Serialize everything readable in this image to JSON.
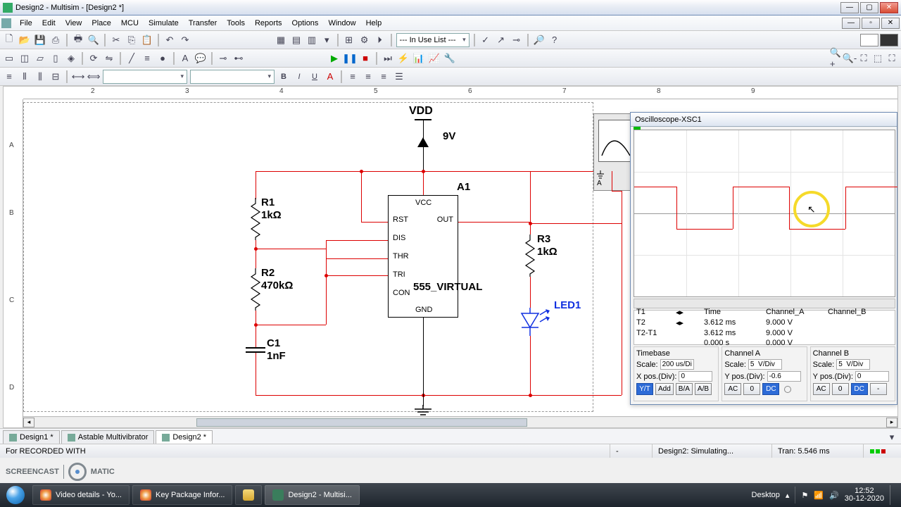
{
  "window": {
    "title": "Design2 - Multisim - [Design2 *]"
  },
  "menu": [
    "File",
    "Edit",
    "View",
    "Place",
    "MCU",
    "Simulate",
    "Transfer",
    "Tools",
    "Reports",
    "Options",
    "Window",
    "Help"
  ],
  "toolbar": {
    "inuse": "--- In Use List ---"
  },
  "ruler": {
    "h": [
      "2",
      "3",
      "4",
      "5",
      "6",
      "7",
      "8",
      "9"
    ],
    "v": [
      "A",
      "B",
      "C",
      "D"
    ]
  },
  "schematic": {
    "vdd": "VDD",
    "voltage": "9V",
    "chip_ref": "A1",
    "chip_name": "555_VIRTUAL",
    "pins": [
      "VCC",
      "RST",
      "OUT",
      "DIS",
      "THR",
      "TRI",
      "CON",
      "GND"
    ],
    "r1_name": "R1",
    "r1_val": "1kΩ",
    "r2_name": "R2",
    "r2_val": "470kΩ",
    "r3_name": "R3",
    "r3_val": "1kΩ",
    "c1_name": "C1",
    "c1_val": "1nF",
    "led": "LED1"
  },
  "scope": {
    "title": "Oscilloscope-XSC1",
    "cursor_rows": [
      "T1",
      "T2",
      "T2-T1"
    ],
    "cursor_hdr": [
      "Time",
      "Channel_A",
      "Channel_B"
    ],
    "readout": {
      "t1_time": "3.612 ms",
      "t1_a": "9.000 V",
      "t2_time": "3.612 ms",
      "t2_a": "9.000 V",
      "dt_time": "0.000 s",
      "dt_a": "0.000 V"
    },
    "timebase_lbl": "Timebase",
    "ch_a_lbl": "Channel A",
    "ch_b_lbl": "Channel B",
    "scale_lbl": "Scale:",
    "xpos_lbl": "X pos.(Div):",
    "ypos_lbl": "Y pos.(Div):",
    "tb_scale": "200 us/Div",
    "a_scale": "5  V/Div",
    "a_ypos": "-0.6",
    "b_scale": "5  V/Div",
    "b_ypos": "0",
    "xpos": "0",
    "btns_tb": [
      "Y/T",
      "Add",
      "B/A",
      "A/B"
    ],
    "btns_ch": [
      "AC",
      "0",
      "DC"
    ]
  },
  "tabs": [
    "Design1 *",
    "Astable Multivibrator",
    "Design2 *"
  ],
  "status": {
    "rec": "For RECORDED WITH",
    "sim": "Design2: Simulating...",
    "tran": "Tran: 5.546 ms"
  },
  "taskbar": {
    "items": [
      "Video details - Yo...",
      "Key Package Infor...",
      "",
      "Design2 - Multisi..."
    ],
    "desktop": "Desktop",
    "time": "12:52",
    "date": "30-12-2020"
  },
  "watermark": {
    "a": "SCREENCAST",
    "b": "MATIC"
  }
}
